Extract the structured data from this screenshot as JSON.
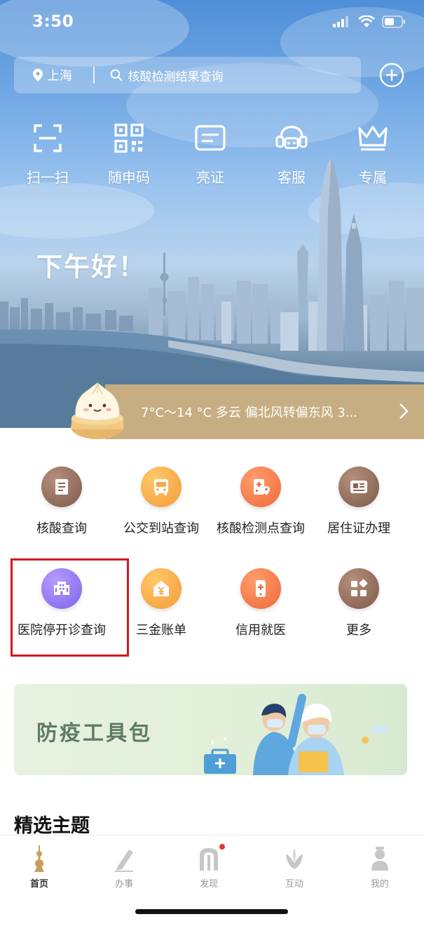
{
  "status_bar": {
    "time": "3:50"
  },
  "search": {
    "city": "上海",
    "placeholder": "核酸检测结果查询"
  },
  "quick_actions": [
    {
      "label": "扫一扫",
      "icon": "scan-icon"
    },
    {
      "label": "随申码",
      "icon": "qr-code-icon"
    },
    {
      "label": "亮证",
      "icon": "id-card-icon"
    },
    {
      "label": "客服",
      "icon": "customer-service-icon"
    },
    {
      "label": "专属",
      "icon": "crown-icon"
    }
  ],
  "greeting": "下午好！",
  "weather": {
    "text": "7°C～14 °C 多云 偏北风转偏东风 3..."
  },
  "services": [
    {
      "label": "核酸查询",
      "icon": "document-icon",
      "color": "#7e5a4b"
    },
    {
      "label": "公交到站查询",
      "icon": "bus-icon",
      "color": "#f49b3a"
    },
    {
      "label": "核酸检测点查询",
      "icon": "hospital-location-icon",
      "color": "#ef6a3a"
    },
    {
      "label": "居住证办理",
      "icon": "card-icon",
      "color": "#7e5a4b"
    },
    {
      "label": "医院停开诊查询",
      "icon": "hospital-building-icon",
      "color": "#7f63e8"
    },
    {
      "label": "三金账单",
      "icon": "yuan-house-icon",
      "color": "#f49b3a"
    },
    {
      "label": "信用就医",
      "icon": "medical-phone-icon",
      "color": "#ef6a3a"
    },
    {
      "label": "更多",
      "icon": "grid-more-icon",
      "color": "#7e5a4b"
    }
  ],
  "highlight_color": "#d8161f",
  "banner": {
    "title": "防疫工具包"
  },
  "section_title": "精选主题",
  "tabs": [
    {
      "label": "首页",
      "icon": "oriental-pearl-tower-icon",
      "active": true
    },
    {
      "label": "办事",
      "icon": "pen-icon",
      "active": false
    },
    {
      "label": "发现",
      "icon": "arch-icon",
      "active": false,
      "badge": true
    },
    {
      "label": "互动",
      "icon": "magnolia-icon",
      "active": false
    },
    {
      "label": "我的",
      "icon": "person-icon",
      "active": false
    }
  ]
}
